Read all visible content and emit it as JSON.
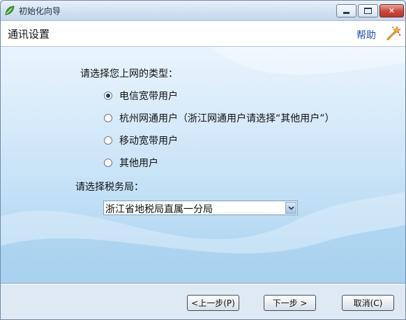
{
  "window": {
    "title": "初始化向导"
  },
  "header": {
    "title": "通讯设置",
    "help_label": "帮助"
  },
  "form": {
    "type_prompt": "请选择您上网的类型：",
    "options": [
      {
        "label": "电信宽带用户",
        "checked": true
      },
      {
        "label": "杭州网通用户（浙江网通用户请选择“其他用户”）",
        "checked": false
      },
      {
        "label": "移动宽带用户",
        "checked": false
      },
      {
        "label": "其他用户",
        "checked": false
      }
    ],
    "tax_prompt": "请选择税务局：",
    "tax_office_selected": "浙江省地税局直属一分局"
  },
  "footer": {
    "prev_label": "<上一步(P)",
    "next_label": "下一步 >",
    "cancel_label": "取消(C)"
  }
}
